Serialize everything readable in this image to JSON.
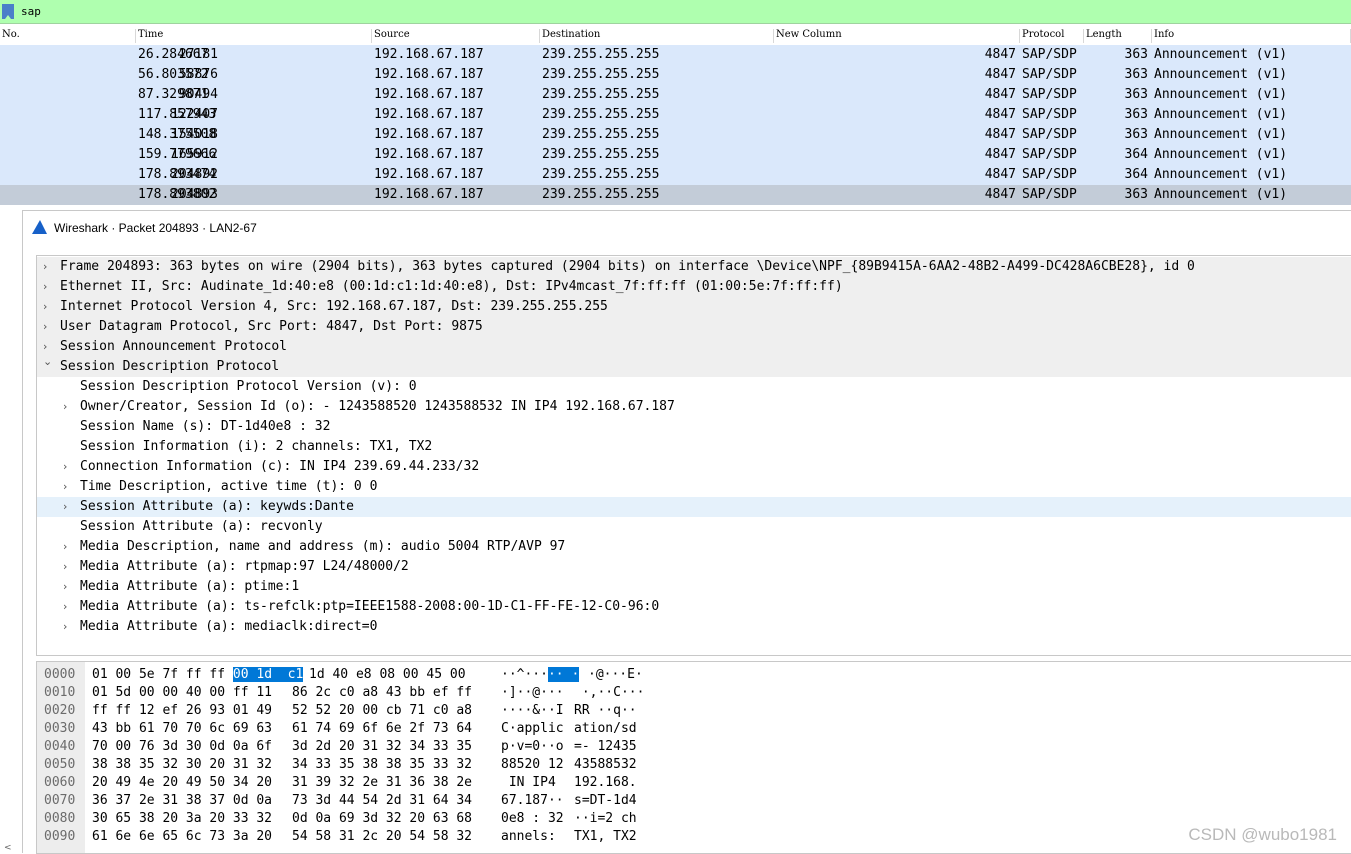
{
  "filter": {
    "value": "sap"
  },
  "packet_list": {
    "columns": [
      "No.",
      "Time",
      "Source",
      "Destination",
      "New Column",
      "Protocol",
      "Length",
      "Info"
    ],
    "rows": [
      [
        "27181",
        "26.284667",
        "192.168.67.187",
        "239.255.255.255",
        "4847",
        "SAP/SDP",
        "363",
        "Announcement (v1)"
      ],
      [
        "58876",
        "56.803572",
        "192.168.67.187",
        "239.255.255.255",
        "4847",
        "SAP/SDP",
        "363",
        "Announcement (v1)"
      ],
      [
        "90494",
        "87.329871",
        "192.168.67.187",
        "239.255.255.255",
        "4847",
        "SAP/SDP",
        "363",
        "Announcement (v1)"
      ],
      [
        "122407",
        "117.857943",
        "192.168.67.187",
        "239.255.255.255",
        "4847",
        "SAP/SDP",
        "363",
        "Announcement (v1)"
      ],
      [
        "154018",
        "148.375508",
        "192.168.67.187",
        "239.255.255.255",
        "4847",
        "SAP/SDP",
        "363",
        "Announcement (v1)"
      ],
      [
        "165912",
        "159.779666",
        "192.168.67.187",
        "239.255.255.255",
        "4847",
        "SAP/SDP",
        "364",
        "Announcement (v1)"
      ],
      [
        "204892",
        "178.893474",
        "192.168.67.187",
        "239.255.255.255",
        "4847",
        "SAP/SDP",
        "364",
        "Announcement (v1)"
      ],
      [
        "204893",
        "178.893802",
        "192.168.67.187",
        "239.255.255.255",
        "4847",
        "SAP/SDP",
        "363",
        "Announcement (v1)"
      ]
    ],
    "selected_row_index": 7
  },
  "packet_window": {
    "title": "Wireshark · Packet 204893 · LAN2-67"
  },
  "details": [
    {
      "indent": 0,
      "arrow": "right",
      "text": "Frame 204893: 363 bytes on wire (2904 bits), 363 bytes captured (2904 bits) on interface \\Device\\NPF_{89B9415A-6AA2-48B2-A499-DC428A6CBE28}, id 0",
      "bg": "gray"
    },
    {
      "indent": 0,
      "arrow": "right",
      "text": "Ethernet II, Src: Audinate_1d:40:e8 (00:1d:c1:1d:40:e8), Dst: IPv4mcast_7f:ff:ff (01:00:5e:7f:ff:ff)",
      "bg": "gray"
    },
    {
      "indent": 0,
      "arrow": "right",
      "text": "Internet Protocol Version 4, Src: 192.168.67.187, Dst: 239.255.255.255",
      "bg": "gray"
    },
    {
      "indent": 0,
      "arrow": "right",
      "text": "User Datagram Protocol, Src Port: 4847, Dst Port: 9875",
      "bg": "gray"
    },
    {
      "indent": 0,
      "arrow": "right",
      "text": "Session Announcement Protocol",
      "bg": "gray"
    },
    {
      "indent": 0,
      "arrow": "down",
      "text": "Session Description Protocol",
      "bg": "gray"
    },
    {
      "indent": 1,
      "arrow": "",
      "text": "Session Description Protocol Version (v): 0",
      "bg": ""
    },
    {
      "indent": 1,
      "arrow": "right",
      "text": "Owner/Creator, Session Id (o): - 1243588520 1243588532 IN IP4 192.168.67.187",
      "bg": ""
    },
    {
      "indent": 1,
      "arrow": "",
      "text": "Session Name (s): DT-1d40e8 : 32",
      "bg": ""
    },
    {
      "indent": 1,
      "arrow": "",
      "text": "Session Information (i): 2 channels: TX1, TX2",
      "bg": ""
    },
    {
      "indent": 1,
      "arrow": "right",
      "text": "Connection Information (c): IN IP4 239.69.44.233/32",
      "bg": ""
    },
    {
      "indent": 1,
      "arrow": "right",
      "text": "Time Description, active time (t): 0 0",
      "bg": ""
    },
    {
      "indent": 1,
      "arrow": "right",
      "text": "Session Attribute (a): keywds:Dante",
      "bg": "hl"
    },
    {
      "indent": 1,
      "arrow": "",
      "text": "Session Attribute (a): recvonly",
      "bg": ""
    },
    {
      "indent": 1,
      "arrow": "right",
      "text": "Media Description, name and address (m): audio 5004 RTP/AVP 97",
      "bg": ""
    },
    {
      "indent": 1,
      "arrow": "right",
      "text": "Media Attribute (a): rtpmap:97 L24/48000/2",
      "bg": ""
    },
    {
      "indent": 1,
      "arrow": "right",
      "text": "Media Attribute (a): ptime:1",
      "bg": ""
    },
    {
      "indent": 1,
      "arrow": "right",
      "text": "Media Attribute (a): ts-refclk:ptp=IEEE1588-2008:00-1D-C1-FF-FE-12-C0-96:0",
      "bg": ""
    },
    {
      "indent": 1,
      "arrow": "right",
      "text": "Media Attribute (a): mediaclk:direct=0",
      "bg": ""
    }
  ],
  "hex": [
    {
      "off": "0000",
      "hx1": "01 00 5e 7f ff ff ",
      "sel1": "00 1d  c1",
      "hx2": "1d 40 e8 08 00 45 00",
      "as1": "··^···",
      "sel2": "·· ·",
      "as2": "·@···E·"
    },
    {
      "off": "0010",
      "hx1": "01 5d 00 00 40 00 ff 11",
      "sel1": "",
      "hx2": "86 2c c0 a8 43 bb ef ff",
      "as1": "·]··@···",
      "sel2": "",
      "as2": " ·,··C···"
    },
    {
      "off": "0020",
      "hx1": "ff ff 12 ef 26 93 01 49",
      "sel1": "",
      "hx2": "52 52 20 00 cb 71 c0 a8",
      "as1": "····&··I",
      "sel2": "",
      "as2": "RR ··q··"
    },
    {
      "off": "0030",
      "hx1": "43 bb 61 70 70 6c 69 63",
      "sel1": "",
      "hx2": "61 74 69 6f 6e 2f 73 64",
      "as1": "C·applic",
      "sel2": "",
      "as2": "ation/sd"
    },
    {
      "off": "0040",
      "hx1": "70 00 76 3d 30 0d 0a 6f",
      "sel1": "",
      "hx2": "3d 2d 20 31 32 34 33 35",
      "as1": "p·v=0··o",
      "sel2": "",
      "as2": "=- 12435"
    },
    {
      "off": "0050",
      "hx1": "38 38 35 32 30 20 31 32",
      "sel1": "",
      "hx2": "34 33 35 38 38 35 33 32",
      "as1": "88520 12",
      "sel2": "",
      "as2": "43588532"
    },
    {
      "off": "0060",
      "hx1": "20 49 4e 20 49 50 34 20",
      "sel1": "",
      "hx2": "31 39 32 2e 31 36 38 2e",
      "as1": " IN IP4 ",
      "sel2": "",
      "as2": "192.168."
    },
    {
      "off": "0070",
      "hx1": "36 37 2e 31 38 37 0d 0a",
      "sel1": "",
      "hx2": "73 3d 44 54 2d 31 64 34",
      "as1": "67.187··",
      "sel2": "",
      "as2": "s=DT-1d4"
    },
    {
      "off": "0080",
      "hx1": "30 65 38 20 3a 20 33 32",
      "sel1": "",
      "hx2": "0d 0a 69 3d 32 20 63 68",
      "as1": "0e8 : 32",
      "sel2": "",
      "as2": "··i=2 ch"
    },
    {
      "off": "0090",
      "hx1": "61 6e 6e 65 6c 73 3a 20",
      "sel1": "",
      "hx2": "54 58 31 2c 20 54 58 32",
      "as1": "annels: ",
      "sel2": "",
      "as2": "TX1, TX2"
    }
  ],
  "watermark": "CSDN @wubo1981",
  "icons": {
    "filter_bookmark": "bookmark-icon",
    "window": "wireshark-fin-icon",
    "expand": "chevron-right-icon",
    "collapse": "chevron-down-icon"
  }
}
